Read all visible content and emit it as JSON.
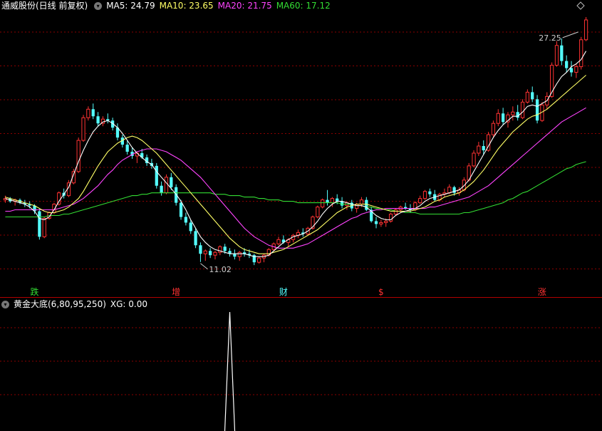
{
  "stock": {
    "title": "通威股份(日线 前复权)"
  },
  "ma_legend": [
    {
      "label": "MA5: 24.79",
      "color": "#ffffff"
    },
    {
      "label": "MA10: 23.65",
      "color": "#ffff66"
    },
    {
      "label": "MA20: 21.75",
      "color": "#ff44ff"
    },
    {
      "label": "MA60: 17.12",
      "color": "#33dd33"
    }
  ],
  "indicator": {
    "title": "黄金大底(6,80,95,250)",
    "value_label": "XG: 0.00"
  },
  "colors": {
    "up": "#ff3232",
    "down": "#54ffff",
    "grid": "#8b0000",
    "ma5": "#ffffff",
    "ma10": "#ffff66",
    "ma20": "#ff44ff",
    "ma60": "#33dd33",
    "xg": "#ffffff"
  },
  "chart_data": {
    "type": "candlestick",
    "y_range": [
      9.5,
      28.6
    ],
    "annotations": [
      {
        "text": "27.25",
        "index": 118,
        "value": 27.25
      },
      {
        "text": "11.02",
        "index": 40,
        "value": 11.02
      }
    ],
    "event_markers": [
      {
        "text": "跌",
        "index": 6,
        "color": "#33dd33"
      },
      {
        "text": "增",
        "index": 35,
        "color": "#ff3232"
      },
      {
        "text": "财",
        "index": 57,
        "color": "#54ffff"
      },
      {
        "text": "$",
        "index": 77,
        "color": "#ff3232"
      },
      {
        "text": "涨",
        "index": 110,
        "color": "#ff3232"
      }
    ],
    "candles": [
      [
        15.4,
        15.7,
        15.2,
        15.5
      ],
      [
        15.5,
        15.6,
        15.2,
        15.3
      ],
      [
        15.3,
        15.5,
        15.0,
        15.4
      ],
      [
        15.4,
        15.5,
        15.1,
        15.2
      ],
      [
        15.2,
        15.4,
        14.9,
        15.1
      ],
      [
        15.1,
        15.3,
        14.8,
        15.0
      ],
      [
        15.0,
        15.1,
        14.4,
        14.6
      ],
      [
        14.6,
        14.8,
        12.6,
        12.8
      ],
      [
        12.8,
        14.2,
        12.7,
        14.1
      ],
      [
        14.1,
        14.6,
        14.0,
        14.5
      ],
      [
        14.5,
        15.2,
        14.4,
        15.1
      ],
      [
        15.1,
        16.0,
        15.0,
        15.9
      ],
      [
        15.9,
        16.2,
        15.5,
        15.7
      ],
      [
        15.7,
        16.8,
        15.6,
        16.6
      ],
      [
        16.6,
        17.6,
        16.5,
        17.4
      ],
      [
        17.4,
        19.8,
        17.3,
        19.6
      ],
      [
        19.6,
        21.4,
        19.5,
        21.2
      ],
      [
        21.2,
        22.0,
        21.0,
        21.8
      ],
      [
        21.8,
        22.2,
        21.1,
        21.3
      ],
      [
        21.3,
        21.6,
        20.6,
        20.8
      ],
      [
        20.8,
        21.3,
        20.6,
        21.1
      ],
      [
        21.1,
        21.5,
        20.8,
        21.0
      ],
      [
        21.0,
        21.2,
        20.3,
        20.5
      ],
      [
        20.5,
        20.8,
        19.6,
        19.8
      ],
      [
        19.8,
        20.0,
        19.1,
        19.3
      ],
      [
        19.3,
        19.6,
        18.6,
        18.8
      ],
      [
        18.8,
        19.1,
        18.3,
        18.5
      ],
      [
        18.5,
        18.8,
        18.0,
        18.7
      ],
      [
        18.7,
        19.0,
        18.3,
        18.4
      ],
      [
        18.4,
        18.6,
        17.8,
        18.0
      ],
      [
        18.0,
        18.3,
        17.6,
        17.8
      ],
      [
        17.8,
        18.0,
        16.2,
        16.4
      ],
      [
        16.4,
        16.7,
        15.7,
        15.9
      ],
      [
        15.9,
        17.2,
        15.8,
        17.0
      ],
      [
        17.0,
        17.3,
        16.1,
        16.3
      ],
      [
        16.3,
        16.5,
        15.0,
        15.2
      ],
      [
        15.2,
        15.4,
        14.0,
        14.2
      ],
      [
        14.2,
        14.5,
        13.6,
        13.8
      ],
      [
        13.8,
        14.0,
        13.0,
        13.2
      ],
      [
        13.2,
        13.4,
        12.0,
        12.2
      ],
      [
        12.2,
        12.4,
        11.02,
        11.6
      ],
      [
        11.6,
        11.9,
        11.1,
        11.8
      ],
      [
        11.8,
        12.0,
        11.3,
        11.5
      ],
      [
        11.5,
        11.8,
        11.2,
        11.7
      ],
      [
        11.7,
        12.2,
        11.5,
        12.1
      ],
      [
        12.1,
        12.3,
        11.6,
        11.8
      ],
      [
        11.8,
        12.0,
        11.4,
        11.6
      ],
      [
        11.6,
        11.9,
        11.2,
        11.4
      ],
      [
        11.4,
        11.8,
        11.1,
        11.7
      ],
      [
        11.7,
        12.0,
        11.4,
        11.6
      ],
      [
        11.6,
        11.9,
        11.3,
        11.5
      ],
      [
        11.5,
        11.6,
        10.8,
        11.0
      ],
      [
        11.0,
        11.4,
        10.9,
        11.3
      ],
      [
        11.3,
        11.6,
        11.0,
        11.5
      ],
      [
        11.5,
        12.0,
        11.4,
        11.9
      ],
      [
        11.9,
        12.4,
        11.8,
        12.3
      ],
      [
        12.3,
        12.8,
        12.2,
        12.6
      ],
      [
        12.6,
        12.9,
        12.3,
        12.4
      ],
      [
        12.4,
        12.7,
        12.1,
        12.6
      ],
      [
        12.6,
        13.0,
        12.4,
        12.9
      ],
      [
        12.9,
        13.3,
        12.7,
        13.1
      ],
      [
        13.1,
        13.4,
        12.8,
        13.0
      ],
      [
        13.0,
        13.5,
        12.9,
        13.4
      ],
      [
        13.4,
        14.3,
        13.3,
        14.2
      ],
      [
        14.2,
        15.0,
        14.1,
        14.9
      ],
      [
        14.9,
        15.5,
        14.8,
        15.4
      ],
      [
        15.4,
        16.1,
        15.0,
        15.2
      ],
      [
        15.2,
        15.6,
        14.9,
        15.5
      ],
      [
        15.5,
        15.8,
        15.1,
        15.3
      ],
      [
        15.3,
        15.6,
        14.8,
        15.0
      ],
      [
        15.0,
        15.3,
        14.7,
        15.2
      ],
      [
        15.2,
        15.4,
        14.6,
        14.8
      ],
      [
        14.8,
        15.2,
        14.5,
        15.1
      ],
      [
        15.1,
        15.6,
        14.9,
        15.4
      ],
      [
        15.4,
        15.6,
        14.6,
        14.7
      ],
      [
        14.7,
        14.9,
        13.8,
        13.9
      ],
      [
        13.9,
        14.2,
        13.4,
        13.7
      ],
      [
        13.7,
        14.0,
        13.5,
        13.8
      ],
      [
        13.8,
        14.1,
        13.5,
        13.9
      ],
      [
        13.9,
        14.5,
        13.8,
        14.4
      ],
      [
        14.4,
        14.8,
        14.3,
        14.7
      ],
      [
        14.7,
        15.0,
        14.5,
        14.9
      ],
      [
        14.9,
        15.2,
        14.7,
        14.8
      ],
      [
        14.8,
        15.1,
        14.5,
        14.7
      ],
      [
        14.7,
        15.3,
        14.6,
        15.2
      ],
      [
        15.2,
        15.7,
        15.1,
        15.5
      ],
      [
        15.5,
        16.1,
        15.4,
        16.0
      ],
      [
        16.0,
        16.2,
        15.6,
        15.8
      ],
      [
        15.8,
        16.1,
        15.3,
        15.4
      ],
      [
        15.4,
        15.9,
        15.3,
        15.8
      ],
      [
        15.8,
        16.2,
        15.6,
        15.9
      ],
      [
        15.9,
        16.5,
        15.8,
        16.3
      ],
      [
        16.3,
        16.4,
        15.7,
        15.9
      ],
      [
        15.9,
        16.3,
        15.7,
        16.1
      ],
      [
        16.1,
        17.0,
        16.0,
        16.8
      ],
      [
        16.8,
        18.0,
        16.7,
        17.8
      ],
      [
        17.8,
        18.9,
        17.7,
        18.7
      ],
      [
        18.7,
        19.5,
        18.5,
        19.2
      ],
      [
        19.2,
        19.6,
        18.6,
        18.9
      ],
      [
        18.9,
        20.2,
        18.8,
        20.0
      ],
      [
        20.0,
        21.0,
        19.8,
        20.8
      ],
      [
        20.8,
        21.8,
        20.6,
        21.5
      ],
      [
        21.5,
        21.9,
        20.7,
        20.9
      ],
      [
        20.9,
        21.6,
        20.5,
        21.4
      ],
      [
        21.4,
        22.0,
        21.0,
        21.6
      ],
      [
        21.6,
        22.1,
        21.0,
        21.2
      ],
      [
        21.2,
        22.5,
        21.1,
        22.3
      ],
      [
        22.3,
        23.2,
        22.2,
        23.0
      ],
      [
        23.0,
        23.4,
        22.3,
        22.5
      ],
      [
        22.5,
        22.8,
        20.8,
        21.0
      ],
      [
        21.0,
        22.3,
        20.9,
        22.1
      ],
      [
        22.1,
        23.0,
        21.8,
        22.7
      ],
      [
        22.7,
        25.1,
        22.6,
        24.9
      ],
      [
        24.9,
        26.6,
        24.8,
        26.3
      ],
      [
        26.3,
        26.8,
        24.9,
        25.2
      ],
      [
        25.2,
        25.6,
        24.4,
        24.7
      ],
      [
        24.7,
        25.2,
        24.1,
        24.4
      ],
      [
        24.4,
        25.0,
        24.0,
        24.8
      ],
      [
        24.8,
        26.9,
        24.6,
        26.7
      ],
      [
        26.7,
        28.3,
        26.6,
        28.1
      ]
    ],
    "ma5": [
      15.5,
      15.4,
      15.3,
      15.2,
      15.1,
      14.9,
      14.6,
      14.1,
      14.0,
      14.2,
      14.7,
      15.3,
      15.8,
      16.3,
      17.2,
      18.1,
      18.9,
      19.6,
      20.2,
      20.6,
      20.9,
      21.0,
      20.8,
      20.5,
      20.1,
      19.6,
      19.1,
      18.7,
      18.4,
      18.1,
      17.9,
      17.4,
      17.0,
      16.6,
      16.2,
      15.8,
      15.3,
      14.7,
      14.0,
      13.4,
      12.8,
      12.4,
      12.1,
      11.9,
      11.8,
      11.7,
      11.6,
      11.6,
      11.6,
      11.6,
      11.5,
      11.4,
      11.4,
      11.4,
      11.5,
      11.8,
      12.1,
      12.4,
      12.6,
      12.8,
      12.9,
      13.0,
      13.2,
      13.5,
      13.9,
      14.4,
      14.8,
      15.1,
      15.3,
      15.3,
      15.2,
      15.1,
      15.0,
      15.0,
      14.9,
      14.6,
      14.3,
      14.1,
      14.0,
      14.0,
      14.3,
      14.5,
      14.6,
      14.7,
      14.8,
      15.0,
      15.3,
      15.5,
      15.6,
      15.7,
      15.8,
      15.9,
      16.0,
      16.1,
      16.4,
      16.8,
      17.4,
      18.0,
      18.6,
      19.2,
      19.8,
      20.3,
      20.7,
      21.0,
      21.3,
      21.3,
      21.6,
      22.0,
      22.1,
      22.0,
      22.2,
      22.4,
      23.0,
      23.6,
      24.1,
      24.4,
      24.8,
      25.0,
      25.3,
      25.9
    ],
    "ma10": [
      15.6,
      15.5,
      15.4,
      15.3,
      15.2,
      15.1,
      15.0,
      14.8,
      14.6,
      14.5,
      14.5,
      14.6,
      14.7,
      14.9,
      15.2,
      15.5,
      16.0,
      16.6,
      17.2,
      17.8,
      18.3,
      18.8,
      19.1,
      19.4,
      19.6,
      19.8,
      19.9,
      19.8,
      19.6,
      19.3,
      19.0,
      18.7,
      18.3,
      17.9,
      17.5,
      17.1,
      16.7,
      16.3,
      15.9,
      15.5,
      15.1,
      14.7,
      14.3,
      13.9,
      13.5,
      13.1,
      12.7,
      12.4,
      12.1,
      11.9,
      11.8,
      11.7,
      11.6,
      11.6,
      11.6,
      11.7,
      11.8,
      11.9,
      12.1,
      12.3,
      12.5,
      12.7,
      12.9,
      13.1,
      13.3,
      13.6,
      13.9,
      14.2,
      14.5,
      14.7,
      14.9,
      15.0,
      15.1,
      15.1,
      15.1,
      15.0,
      14.9,
      14.8,
      14.7,
      14.6,
      14.6,
      14.6,
      14.6,
      14.6,
      14.7,
      14.8,
      14.9,
      15.1,
      15.3,
      15.4,
      15.6,
      15.7,
      15.8,
      15.9,
      16.1,
      16.4,
      16.7,
      17.1,
      17.5,
      18.0,
      18.5,
      19.0,
      19.4,
      19.8,
      20.2,
      20.5,
      20.8,
      21.1,
      21.3,
      21.4,
      21.6,
      21.8,
      22.1,
      22.4,
      22.7,
      23.0,
      23.3,
      23.6,
      23.9,
      24.2
    ],
    "ma20": [
      14.6,
      14.6,
      14.7,
      14.7,
      14.7,
      14.7,
      14.7,
      14.7,
      14.7,
      14.7,
      14.7,
      14.8,
      14.9,
      15.0,
      15.1,
      15.3,
      15.5,
      15.8,
      16.1,
      16.4,
      16.8,
      17.2,
      17.5,
      17.9,
      18.2,
      18.4,
      18.6,
      18.8,
      18.9,
      19.0,
      19.0,
      19.0,
      18.9,
      18.8,
      18.6,
      18.4,
      18.2,
      17.9,
      17.6,
      17.3,
      17.0,
      16.6,
      16.2,
      15.8,
      15.4,
      15.0,
      14.6,
      14.2,
      13.8,
      13.4,
      13.1,
      12.8,
      12.6,
      12.4,
      12.2,
      12.1,
      12.0,
      12.0,
      12.0,
      12.0,
      12.1,
      12.2,
      12.3,
      12.5,
      12.7,
      12.9,
      13.1,
      13.3,
      13.5,
      13.7,
      13.9,
      14.1,
      14.2,
      14.4,
      14.5,
      14.6,
      14.7,
      14.7,
      14.8,
      14.8,
      14.8,
      14.8,
      14.8,
      14.8,
      14.8,
      14.8,
      14.8,
      14.9,
      14.9,
      15.0,
      15.1,
      15.2,
      15.3,
      15.4,
      15.5,
      15.6,
      15.8,
      16.0,
      16.2,
      16.4,
      16.7,
      17.0,
      17.3,
      17.6,
      17.9,
      18.2,
      18.5,
      18.8,
      19.1,
      19.4,
      19.7,
      20.0,
      20.3,
      20.6,
      20.9,
      21.1,
      21.3,
      21.5,
      21.7,
      21.9
    ],
    "ma60": [
      14.2,
      14.2,
      14.2,
      14.2,
      14.2,
      14.2,
      14.2,
      14.2,
      14.2,
      14.3,
      14.3,
      14.3,
      14.4,
      14.4,
      14.5,
      14.6,
      14.7,
      14.8,
      14.9,
      15.0,
      15.1,
      15.2,
      15.3,
      15.4,
      15.5,
      15.6,
      15.7,
      15.7,
      15.8,
      15.8,
      15.9,
      15.9,
      15.9,
      15.9,
      15.9,
      15.9,
      15.9,
      15.9,
      15.9,
      15.9,
      15.9,
      15.9,
      15.9,
      15.8,
      15.8,
      15.8,
      15.7,
      15.7,
      15.7,
      15.6,
      15.6,
      15.6,
      15.5,
      15.5,
      15.4,
      15.4,
      15.4,
      15.3,
      15.3,
      15.3,
      15.2,
      15.2,
      15.2,
      15.2,
      15.2,
      15.2,
      15.2,
      15.2,
      15.2,
      15.1,
      15.1,
      15.1,
      15.0,
      15.0,
      14.9,
      14.9,
      14.8,
      14.8,
      14.7,
      14.7,
      14.6,
      14.6,
      14.5,
      14.5,
      14.5,
      14.4,
      14.4,
      14.4,
      14.4,
      14.4,
      14.4,
      14.4,
      14.4,
      14.4,
      14.5,
      14.5,
      14.6,
      14.7,
      14.8,
      14.9,
      15.0,
      15.1,
      15.2,
      15.4,
      15.5,
      15.7,
      15.9,
      16.0,
      16.2,
      16.4,
      16.6,
      16.8,
      17.0,
      17.2,
      17.4,
      17.6,
      17.7,
      17.9,
      18.0,
      18.1
    ],
    "xg_signal": {
      "index": 46,
      "value": 1,
      "range": [
        0,
        1
      ]
    }
  }
}
